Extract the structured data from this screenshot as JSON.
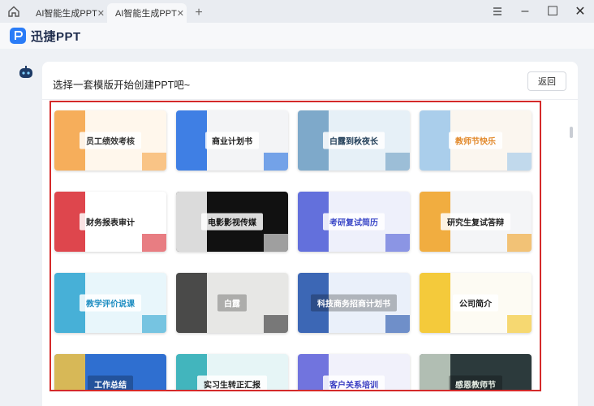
{
  "tabs": [
    {
      "label": "AI智能生成PPT",
      "close": "✕"
    },
    {
      "label": "AI智能生成PPT",
      "close": "✕"
    }
  ],
  "new_tab": "+",
  "window": {
    "minimize": "–",
    "restore": "☐",
    "close": "✕"
  },
  "brand": {
    "name": "迅捷PPT"
  },
  "panel": {
    "title": "选择一套模版开始创建PPT吧~",
    "back_label": "返回"
  },
  "templates": [
    {
      "title": "员工绩效考核",
      "bg": "#fff7ec",
      "accent": "#f5a142",
      "fg": "#333"
    },
    {
      "title": "商业计划书",
      "bg": "#f3f4f6",
      "accent": "#1e6ae0",
      "fg": "#222"
    },
    {
      "title": "白露到秋夜长",
      "bg": "#e6f0f7",
      "accent": "#6b9cc2",
      "fg": "#23405a"
    },
    {
      "title": "教师节快乐",
      "bg": "#fbf6ef",
      "accent": "#9bc7ea",
      "fg": "#e2892b"
    },
    {
      "title": "财务报表审计",
      "bg": "#ffffff",
      "accent": "#d8262e",
      "fg": "#222"
    },
    {
      "title": "电影影视传媒",
      "bg": "#111111",
      "accent": "#ffffff",
      "fg": "#111"
    },
    {
      "title": "考研复试简历",
      "bg": "#eef0fb",
      "accent": "#4a59d6",
      "fg": "#3a47c7"
    },
    {
      "title": "研究生复试答辩",
      "bg": "#f4f5f7",
      "accent": "#f0a020",
      "fg": "#222"
    },
    {
      "title": "教学评价说课",
      "bg": "#e8f6fb",
      "accent": "#2aa3d0",
      "fg": "#1f8ec2"
    },
    {
      "title": "白露",
      "bg": "#e7e7e5",
      "accent": "#2e2e2e",
      "fg": "#ffffff"
    },
    {
      "title": "科技商务招商计划书",
      "bg": "#eaf0fa",
      "accent": "#1d4fa8",
      "fg": "#ffffff"
    },
    {
      "title": "公司简介",
      "bg": "#fdfbf3",
      "accent": "#f2c11a",
      "fg": "#222"
    },
    {
      "title": "工作总结",
      "bg": "#2f6fd0",
      "accent": "#f5c542",
      "fg": "#ffffff"
    },
    {
      "title": "实习生转正汇报",
      "bg": "#e6f5f6",
      "accent": "#25a9b3",
      "fg": "#222"
    },
    {
      "title": "客户关系培训",
      "bg": "#f1f1fb",
      "accent": "#5a5ed8",
      "fg": "#3a3ec2"
    },
    {
      "title": "感恩教师节",
      "bg": "#2c3a3c",
      "accent": "#c9d6c8",
      "fg": "#e8efe6"
    }
  ]
}
